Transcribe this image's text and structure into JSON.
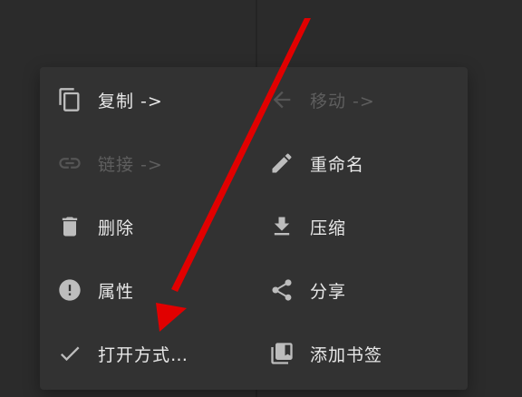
{
  "menu": {
    "items": [
      {
        "label": "复制 ->",
        "icon": "copy-icon",
        "disabled": false
      },
      {
        "label": "移动 ->",
        "icon": "move-icon",
        "disabled": true
      },
      {
        "label": "链接 ->",
        "icon": "link-icon",
        "disabled": true
      },
      {
        "label": "重命名",
        "icon": "pencil-icon",
        "disabled": false
      },
      {
        "label": "删除",
        "icon": "trash-icon",
        "disabled": false
      },
      {
        "label": "压缩",
        "icon": "download-icon",
        "disabled": false
      },
      {
        "label": "属性",
        "icon": "info-icon",
        "disabled": false
      },
      {
        "label": "分享",
        "icon": "share-icon",
        "disabled": false
      },
      {
        "label": "打开方式…",
        "icon": "check-icon",
        "disabled": false
      },
      {
        "label": "添加书签",
        "icon": "bookmark-icon",
        "disabled": false
      }
    ]
  },
  "colors": {
    "menu_background": "#323232",
    "text": "#e8e8e8",
    "disabled_text": "#5e5e5e",
    "annotation_arrow": "#e10000"
  }
}
